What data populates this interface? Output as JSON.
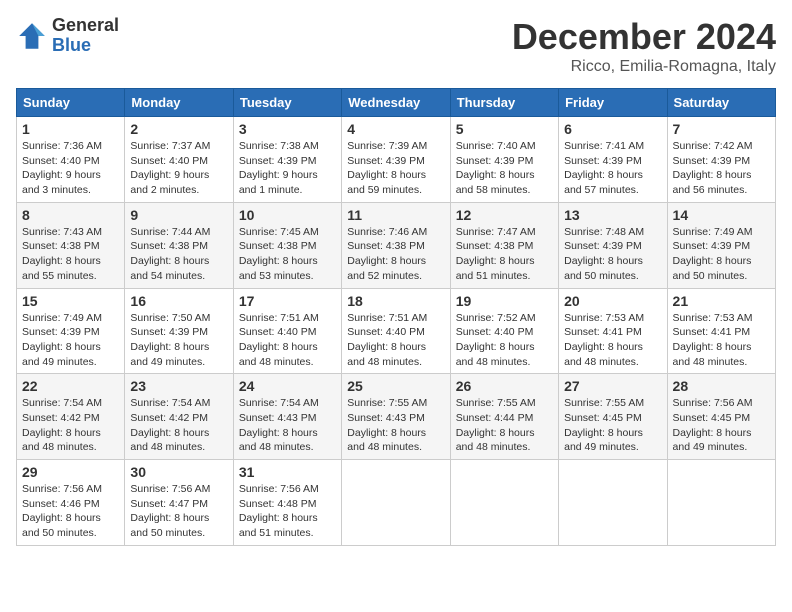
{
  "logo": {
    "general": "General",
    "blue": "Blue"
  },
  "header": {
    "month": "December 2024",
    "location": "Ricco, Emilia-Romagna, Italy"
  },
  "weekdays": [
    "Sunday",
    "Monday",
    "Tuesday",
    "Wednesday",
    "Thursday",
    "Friday",
    "Saturday"
  ],
  "weeks": [
    [
      {
        "day": 1,
        "sunrise": "7:36 AM",
        "sunset": "4:40 PM",
        "daylight": "9 hours and 3 minutes."
      },
      {
        "day": 2,
        "sunrise": "7:37 AM",
        "sunset": "4:40 PM",
        "daylight": "9 hours and 2 minutes."
      },
      {
        "day": 3,
        "sunrise": "7:38 AM",
        "sunset": "4:39 PM",
        "daylight": "9 hours and 1 minute."
      },
      {
        "day": 4,
        "sunrise": "7:39 AM",
        "sunset": "4:39 PM",
        "daylight": "8 hours and 59 minutes."
      },
      {
        "day": 5,
        "sunrise": "7:40 AM",
        "sunset": "4:39 PM",
        "daylight": "8 hours and 58 minutes."
      },
      {
        "day": 6,
        "sunrise": "7:41 AM",
        "sunset": "4:39 PM",
        "daylight": "8 hours and 57 minutes."
      },
      {
        "day": 7,
        "sunrise": "7:42 AM",
        "sunset": "4:39 PM",
        "daylight": "8 hours and 56 minutes."
      }
    ],
    [
      {
        "day": 8,
        "sunrise": "7:43 AM",
        "sunset": "4:38 PM",
        "daylight": "8 hours and 55 minutes."
      },
      {
        "day": 9,
        "sunrise": "7:44 AM",
        "sunset": "4:38 PM",
        "daylight": "8 hours and 54 minutes."
      },
      {
        "day": 10,
        "sunrise": "7:45 AM",
        "sunset": "4:38 PM",
        "daylight": "8 hours and 53 minutes."
      },
      {
        "day": 11,
        "sunrise": "7:46 AM",
        "sunset": "4:38 PM",
        "daylight": "8 hours and 52 minutes."
      },
      {
        "day": 12,
        "sunrise": "7:47 AM",
        "sunset": "4:38 PM",
        "daylight": "8 hours and 51 minutes."
      },
      {
        "day": 13,
        "sunrise": "7:48 AM",
        "sunset": "4:39 PM",
        "daylight": "8 hours and 50 minutes."
      },
      {
        "day": 14,
        "sunrise": "7:49 AM",
        "sunset": "4:39 PM",
        "daylight": "8 hours and 50 minutes."
      }
    ],
    [
      {
        "day": 15,
        "sunrise": "7:49 AM",
        "sunset": "4:39 PM",
        "daylight": "8 hours and 49 minutes."
      },
      {
        "day": 16,
        "sunrise": "7:50 AM",
        "sunset": "4:39 PM",
        "daylight": "8 hours and 49 minutes."
      },
      {
        "day": 17,
        "sunrise": "7:51 AM",
        "sunset": "4:40 PM",
        "daylight": "8 hours and 48 minutes."
      },
      {
        "day": 18,
        "sunrise": "7:51 AM",
        "sunset": "4:40 PM",
        "daylight": "8 hours and 48 minutes."
      },
      {
        "day": 19,
        "sunrise": "7:52 AM",
        "sunset": "4:40 PM",
        "daylight": "8 hours and 48 minutes."
      },
      {
        "day": 20,
        "sunrise": "7:53 AM",
        "sunset": "4:41 PM",
        "daylight": "8 hours and 48 minutes."
      },
      {
        "day": 21,
        "sunrise": "7:53 AM",
        "sunset": "4:41 PM",
        "daylight": "8 hours and 48 minutes."
      }
    ],
    [
      {
        "day": 22,
        "sunrise": "7:54 AM",
        "sunset": "4:42 PM",
        "daylight": "8 hours and 48 minutes."
      },
      {
        "day": 23,
        "sunrise": "7:54 AM",
        "sunset": "4:42 PM",
        "daylight": "8 hours and 48 minutes."
      },
      {
        "day": 24,
        "sunrise": "7:54 AM",
        "sunset": "4:43 PM",
        "daylight": "8 hours and 48 minutes."
      },
      {
        "day": 25,
        "sunrise": "7:55 AM",
        "sunset": "4:43 PM",
        "daylight": "8 hours and 48 minutes."
      },
      {
        "day": 26,
        "sunrise": "7:55 AM",
        "sunset": "4:44 PM",
        "daylight": "8 hours and 48 minutes."
      },
      {
        "day": 27,
        "sunrise": "7:55 AM",
        "sunset": "4:45 PM",
        "daylight": "8 hours and 49 minutes."
      },
      {
        "day": 28,
        "sunrise": "7:56 AM",
        "sunset": "4:45 PM",
        "daylight": "8 hours and 49 minutes."
      }
    ],
    [
      {
        "day": 29,
        "sunrise": "7:56 AM",
        "sunset": "4:46 PM",
        "daylight": "8 hours and 50 minutes."
      },
      {
        "day": 30,
        "sunrise": "7:56 AM",
        "sunset": "4:47 PM",
        "daylight": "8 hours and 50 minutes."
      },
      {
        "day": 31,
        "sunrise": "7:56 AM",
        "sunset": "4:48 PM",
        "daylight": "8 hours and 51 minutes."
      },
      null,
      null,
      null,
      null
    ]
  ]
}
